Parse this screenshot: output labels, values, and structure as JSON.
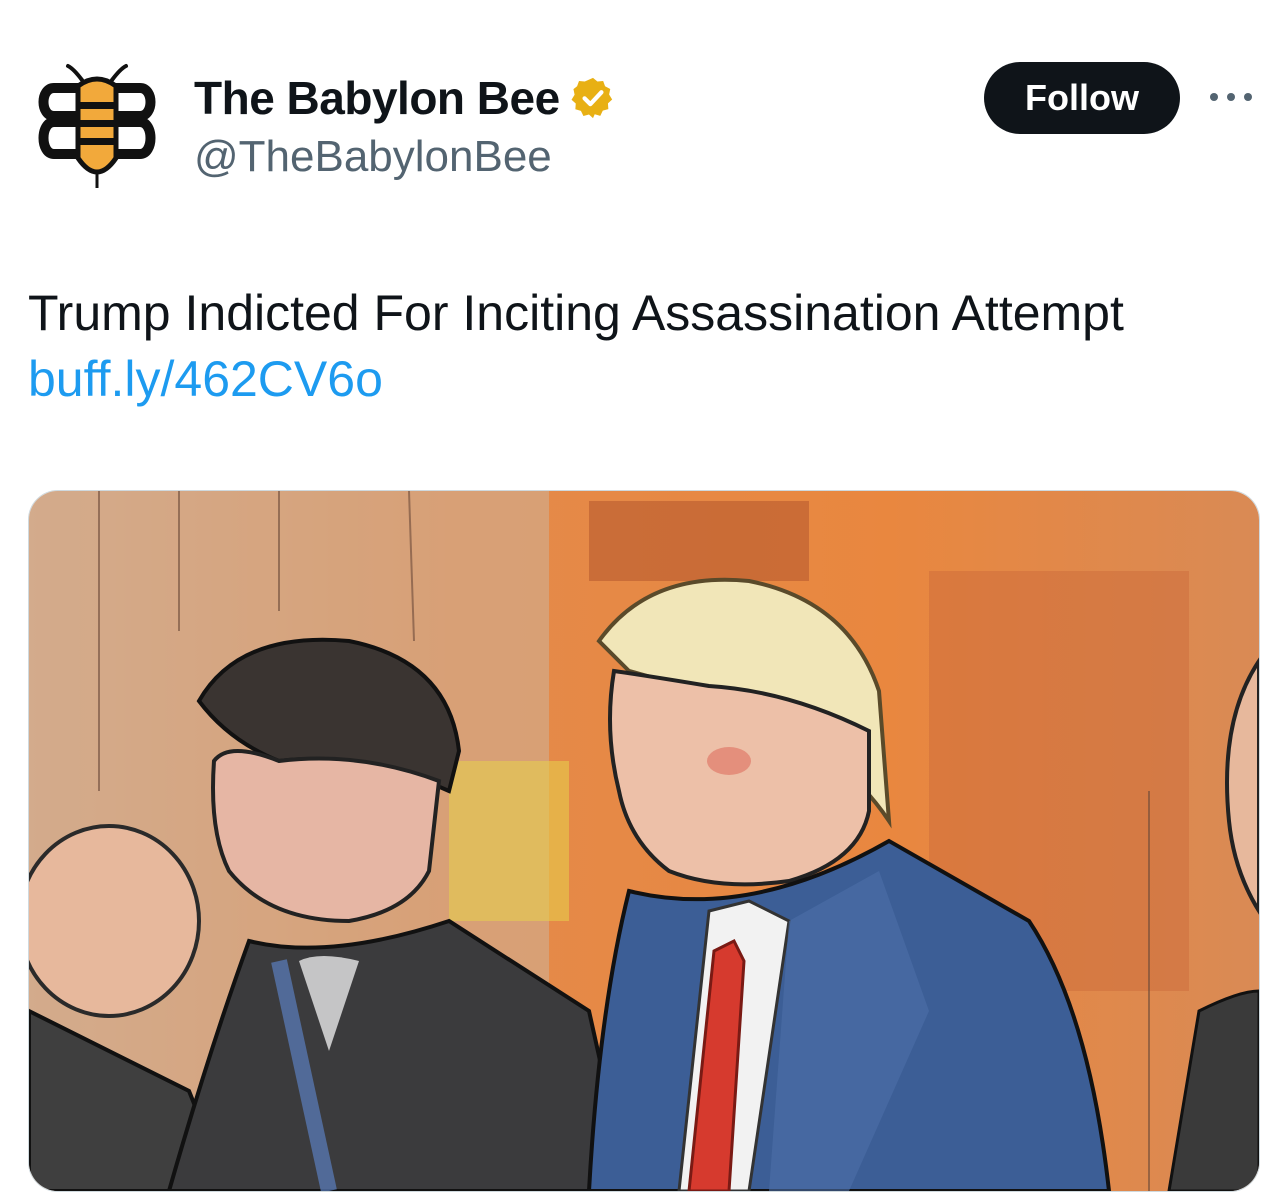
{
  "author": {
    "name": "The Babylon Bee",
    "handle": "@TheBabylonBee",
    "avatar_icon": "babylon-bee-logo-icon",
    "verified_icon": "verified-badge-icon",
    "verified_color": "#e8b014"
  },
  "actions": {
    "follow_label": "Follow",
    "more_icon": "more-options-icon"
  },
  "tweet": {
    "text": "Trump Indicted For Inciting Assassination Attempt",
    "link": "buff.ly/462CV6o",
    "link_color": "#1d9bf0"
  },
  "media": {
    "kind": "courtroom-sketch-image"
  },
  "colors": {
    "text_primary": "#0f1419",
    "text_secondary": "#536471",
    "follow_bg": "#0f1419"
  }
}
